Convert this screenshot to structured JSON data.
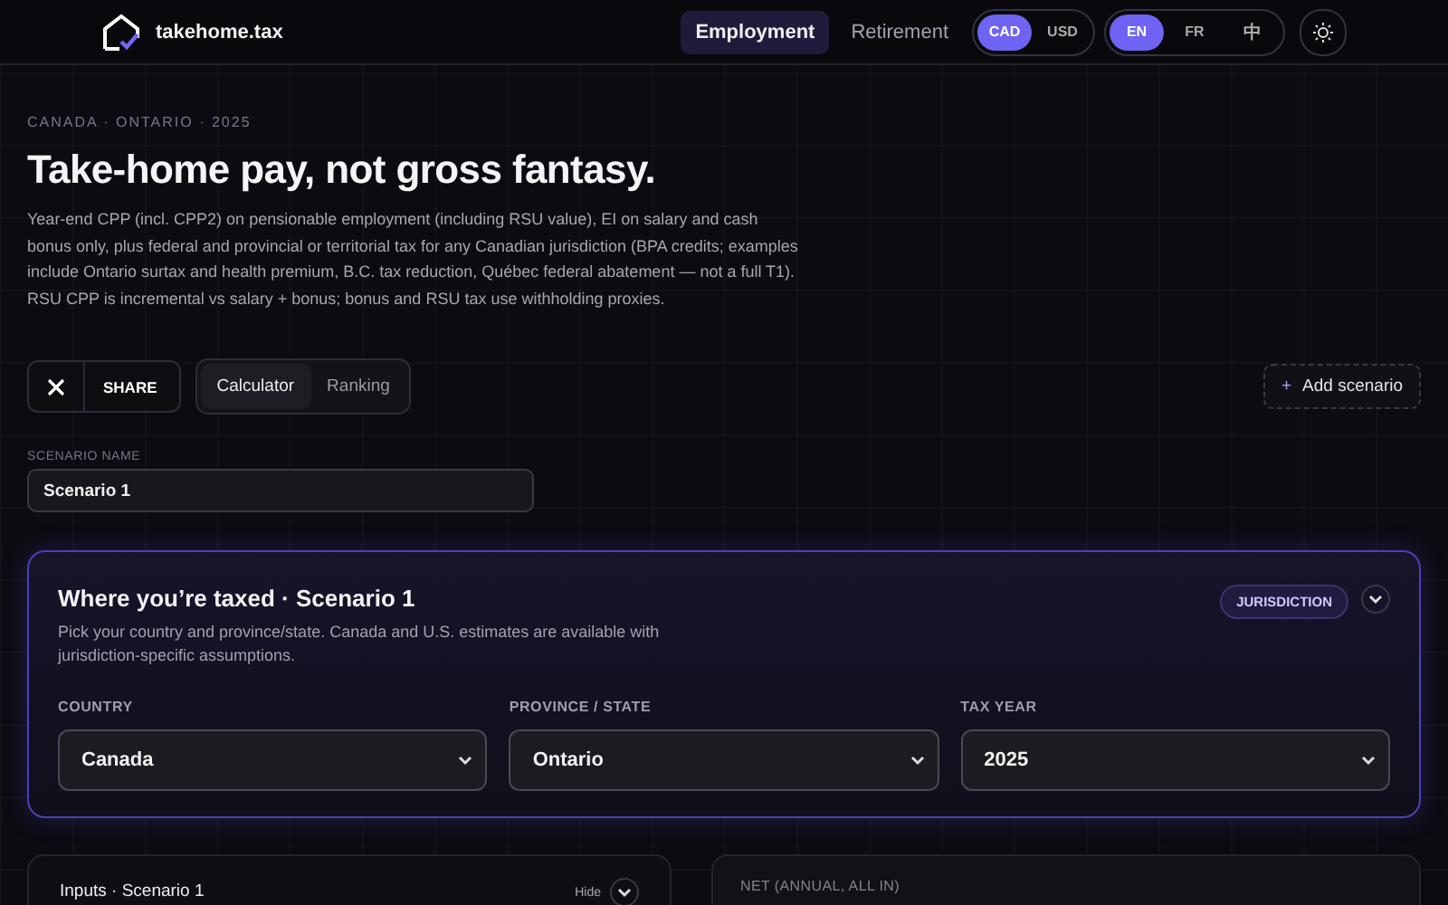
{
  "brand": {
    "name": "takehome.tax"
  },
  "nav": [
    {
      "label": "Employment",
      "selected": true
    },
    {
      "label": "Retirement",
      "selected": false
    }
  ],
  "currency": [
    {
      "label": "CAD",
      "selected": true
    },
    {
      "label": "USD",
      "selected": false
    }
  ],
  "language": [
    {
      "label": "EN",
      "selected": true
    },
    {
      "label": "FR",
      "selected": false
    },
    {
      "label": "中",
      "selected": false
    }
  ],
  "eyebrow": "CANADA · ONTARIO · 2025",
  "title": "Take-home pay, not gross fantasy.",
  "description": "Year-end CPP (incl. CPP2) on pensionable employment (including RSU value), EI on salary and cash bonus only, plus federal and provincial or territorial tax for any Canadian jurisdiction (BPA credits; examples include Ontario surtax and health premium, B.C. tax reduction, Québec federal abatement — not a full T1). RSU CPP is incremental vs salary + bonus; bonus and RSU tax use withholding proxies.",
  "share": {
    "label": "SHARE"
  },
  "view_tabs": [
    {
      "label": "Calculator",
      "selected": true
    },
    {
      "label": "Ranking",
      "selected": false
    }
  ],
  "add_scenario": {
    "icon": "+",
    "label": "Add scenario"
  },
  "scenario_name": {
    "label": "SCENARIO NAME",
    "value": "Scenario 1"
  },
  "jurisdiction_card": {
    "title": "Where you’re taxed · Scenario 1",
    "description": "Pick your country and province/state. Canada and U.S. estimates are available with jurisdiction-specific assumptions.",
    "badge": "JURISDICTION",
    "fields": [
      {
        "label": "COUNTRY",
        "value": "Canada"
      },
      {
        "label": "PROVINCE / STATE",
        "value": "Ontario"
      },
      {
        "label": "TAX YEAR",
        "value": "2025"
      }
    ]
  },
  "inputs_card": {
    "title": "Inputs · Scenario 1",
    "toggle": "Hide"
  },
  "net_card": {
    "label": "NET (ANNUAL, ALL IN)"
  }
}
